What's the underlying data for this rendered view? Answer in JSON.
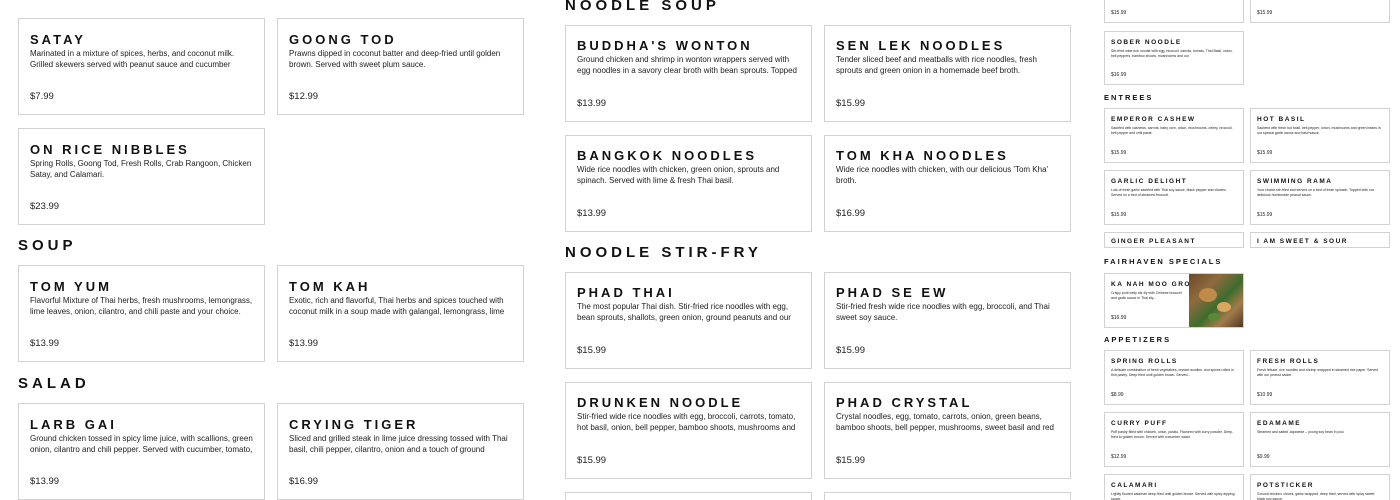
{
  "left_column": {
    "appetizers_top": [
      {
        "title": "Satay",
        "desc": "Marinated in a mixture of spices, herbs, and coconut milk. Grilled skewers served with peanut sauce and cucumber salad. Your",
        "price": "$7.99"
      },
      {
        "title": "Goong Tod",
        "desc": "Prawns dipped in coconut batter and deep-fried until golden brown. Served with sweet plum sauce.",
        "price": "$12.99"
      },
      {
        "title": "On Rice Nibbles",
        "desc": "Spring Rolls, Goong Tod, Fresh Rolls, Crab Rangoon, Chicken Satay, and Calamari.",
        "price": "$23.99"
      }
    ],
    "soup_heading": "Soup",
    "soup": [
      {
        "title": "Tom Yum",
        "desc": "Flavorful Mixture of Thai herbs, fresh mushrooms, lemongrass, lime leaves, onion, cilantro, and chili paste and your choice.",
        "price": "$13.99"
      },
      {
        "title": "Tom Kah",
        "desc": "Exotic, rich and flavorful, Thai herbs and spices touched with coconut milk in a soup made with galangal, lemongrass, lime",
        "price": "$13.99"
      }
    ],
    "salad_heading": "Salad",
    "salad": [
      {
        "title": "Larb Gai",
        "desc": "Ground chicken tossed in spicy lime juice, with scallions, green onion, cilantro and chili pepper. Served with cucumber, tomato, a",
        "price": "$13.99"
      },
      {
        "title": "Crying Tiger",
        "desc": "Sliced and grilled steak in lime juice dressing tossed with Thai basil, chili pepper, cilantro, onion and a touch of ground roasted",
        "price": "$16.99"
      }
    ]
  },
  "middle_column": {
    "noodle_soup_heading": "Noodle Soup",
    "noodle_soup": [
      {
        "title": "Buddha's Wonton",
        "desc": "Ground chicken and shrimp in wonton wrappers served with egg noodles in a savory clear broth with bean sprouts. Topped with",
        "price": "$13.99"
      },
      {
        "title": "Sen Lek Noodles",
        "desc": "Tender sliced beef and meatballs with rice noodles, fresh sprouts and green onion in a homemade beef broth.",
        "price": "$15.99"
      },
      {
        "title": "Bangkok Noodles",
        "desc": "Wide rice noodles with chicken, green onion, sprouts and spinach. Served with lime & fresh Thai basil.",
        "price": "$13.99"
      },
      {
        "title": "Tom Kha Noodles",
        "desc": "Wide rice noodles with chicken, with our delicious 'Tom Kha' broth.",
        "price": "$16.99"
      }
    ],
    "stir_fry_heading": "Noodle Stir-Fry",
    "stir_fry": [
      {
        "title": "Phad Thai",
        "desc": "The most popular Thai dish. Stir-fried rice noodles with egg, bean sprouts, shallots, green onion, ground peanuts and our special",
        "price": "$15.99"
      },
      {
        "title": "Phad Se Ew",
        "desc": "Stir-fried fresh wide rice noodles with egg, broccoli, and Thai sweet soy sauce.",
        "price": "$15.99"
      },
      {
        "title": "Drunken Noodle",
        "desc": "Stir-fried wide rice noodles with egg, broccoli, carrots, tomato, hot basil, onion, bell pepper, bamboo shoots, mushrooms and chili",
        "price": "$15.99"
      },
      {
        "title": "Phad Crystal",
        "desc": "Crystal noodles, egg, tomato, carrots, onion, green beans, bamboo shoots, bell pepper, mushrooms, sweet basil and red curry paste.",
        "price": "$15.99"
      }
    ]
  },
  "right_panel": {
    "top_prices": [
      "$15.99",
      "$15.99"
    ],
    "sober_noodle": {
      "title": "Sober Noodle",
      "desc": "Stir-fried wide rice noodle with egg, broccoli, carrots, tomato, Thai Basil, onion, bell peppers, bamboo shoots, mushrooms and our",
      "price": "$16.99"
    },
    "entrees_heading": "Entrees",
    "entrees": [
      {
        "title": "Emperor Cashew",
        "desc": "Sautéed with cashews, carrots, baby corn, onion, mushrooms, celery, broccoli, bell pepper and chili paste.",
        "price": "$15.99"
      },
      {
        "title": "Hot Basil",
        "desc": "Sautéed with fresh hot basil, bell pepper, onion, mushrooms and green beans in our special garlic sauce and basil sauce.",
        "price": "$15.99"
      },
      {
        "title": "Garlic Delight",
        "desc": "Lots of fresh garlic sautéed with Thai soy sauce, black pepper and cilantro. Served on a bed of steamed broccoli.",
        "price": "$15.99"
      },
      {
        "title": "Swimming Rama",
        "desc": "Your choice stir-fried and served on a bed of fresh spinach. Topped with our delicious homemade peanut sauce.",
        "price": "$15.99"
      },
      {
        "title": "Ginger Pleasant",
        "desc": "",
        "price": ""
      },
      {
        "title": "I Am Sweet & Sour",
        "desc": "",
        "price": ""
      }
    ],
    "specials_heading": "Fairhaven Specials",
    "special": {
      "title": "Ka Nah Moo Grob",
      "desc": "Crispy pork belly stir-fry with Chinese broccoli and garlic sauce in Thai sty...",
      "price": "$16.99"
    },
    "appetizers_heading": "Appetizers",
    "appetizers": [
      {
        "title": "Spring Rolls",
        "desc": "A delicate combination of fresh vegetables, crystal noodles, and spices rolled in thin pastry. Deep fried until golden brown. Served...",
        "price": "$8.99"
      },
      {
        "title": "Fresh Rolls",
        "desc": "Fresh lettuce, rice noodles and shrimp wrapped in steamed rice paper. Served with our peanut sauce.",
        "price": "$10.99"
      },
      {
        "title": "Curry Puff",
        "desc": "Puff pastry filled with chicken, onion, potato. Flavored with curry powder. Deep-fried to golden brown. Served with cucumber salad.",
        "price": "$12.99"
      },
      {
        "title": "Edamame",
        "desc": "Steamed and salted Japanese – young soy bean in pod.",
        "price": "$9.99"
      },
      {
        "title": "Calamari",
        "desc": "Lightly floured calamari deep-fried until golden brown. Served with spicy dipping sauce.",
        "price": ""
      },
      {
        "title": "Potsticker",
        "desc": "Ground chicken, chives, garlic wrapped, deep fried, served with spicy sweet black soy sauce.",
        "price": ""
      }
    ]
  }
}
